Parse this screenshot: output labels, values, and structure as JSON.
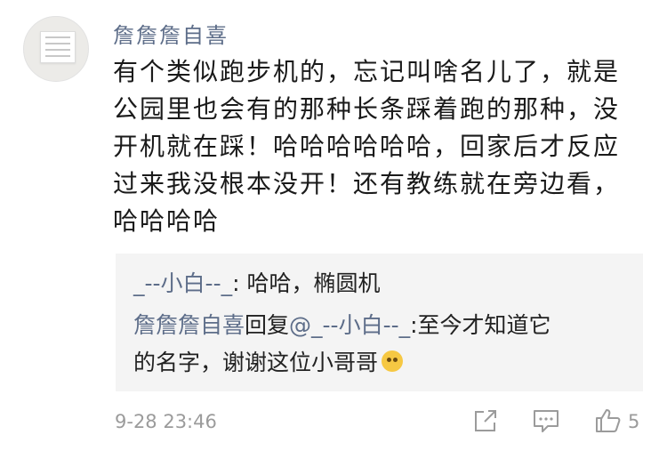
{
  "comment": {
    "username": "詹詹詹自喜",
    "text_lines": [
      "有个类似跑步机的，忘记叫啥名儿了，就是",
      "公园里也会有的那种长条踩着跑的那种，没",
      "开机就在踩！哈哈哈哈哈哈，回家后才反应",
      "过来我没根本没开！还有教练就在旁边看，",
      "哈哈哈哈"
    ],
    "timestamp": "9-28 23:46",
    "like_count": "5"
  },
  "replies": [
    {
      "author": "_--小白--_",
      "separator": ": ",
      "text": "哈哈，椭圆机"
    },
    {
      "author": "詹詹詹自喜",
      "action": "回复",
      "mention": "@_--小白--_",
      "text_line1": ":至今才知道它",
      "text_line2": "的名字，谢谢这位小哥哥",
      "emoji": "laughing-tears"
    }
  ],
  "icons": {
    "share": "share-icon",
    "comment": "comment-icon",
    "like": "thumbs-up-icon"
  },
  "colors": {
    "link": "#5d6d89",
    "text": "#1a1a1a",
    "meta": "#9b9b9b",
    "reply_bg": "#f4f4f4"
  }
}
